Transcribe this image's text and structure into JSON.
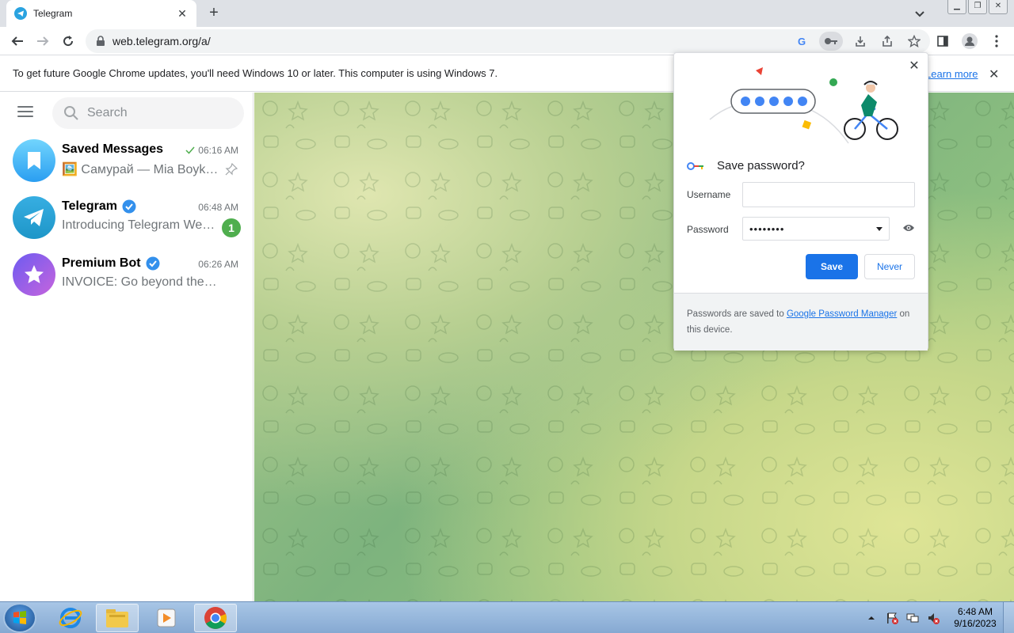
{
  "browser": {
    "tab_title": "Telegram",
    "url": "web.telegram.org/a/"
  },
  "infobar": {
    "message": "To get future Google Chrome updates, you'll need Windows 10 or later. This computer is using Windows 7.",
    "learn_more": "Learn more"
  },
  "sidebar": {
    "search_placeholder": "Search",
    "chats": [
      {
        "name": "Saved Messages",
        "time": "06:16 AM",
        "preview": "🖼️ Самурай — Mia Boyka, Т...",
        "read": true,
        "pinned": true
      },
      {
        "name": "Telegram",
        "time": "06:48 AM",
        "preview": "Introducing Telegram Web A...",
        "verified": true,
        "unread": "1"
      },
      {
        "name": "Premium Bot",
        "time": "06:26 AM",
        "preview": "INVOICE: Go beyond the limits...",
        "verified": true
      }
    ]
  },
  "save_password": {
    "title": "Save password?",
    "username_label": "Username",
    "username_value": "",
    "password_label": "Password",
    "password_value": "••••••••",
    "save_button": "Save",
    "never_button": "Never",
    "footer_prefix": "Passwords are saved to",
    "footer_link": "Google Password Manager",
    "footer_suffix": "on this device."
  },
  "taskbar": {
    "time": "6:48 AM",
    "date": "9/16/2023"
  },
  "colors": {
    "chrome_blue": "#1a73e8",
    "telegram_blue": "#2aa3e0",
    "unread_green": "#4fae4e"
  }
}
